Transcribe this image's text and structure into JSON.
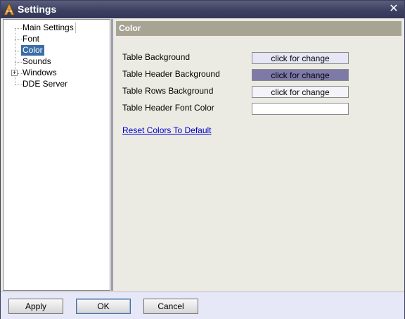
{
  "window": {
    "title": "Settings",
    "close_glyph": "✕"
  },
  "tree": {
    "items": [
      {
        "label": "Main Settings",
        "name": "tree-item-main-settings"
      },
      {
        "label": "Font",
        "name": "tree-item-font"
      },
      {
        "label": "Color",
        "name": "tree-item-color",
        "selected": true
      },
      {
        "label": "Sounds",
        "name": "tree-item-sounds"
      },
      {
        "label": "Windows",
        "name": "tree-item-windows",
        "expandable": true,
        "expander_glyph": "+"
      },
      {
        "label": "DDE Server",
        "name": "tree-item-dde-server"
      }
    ]
  },
  "section": {
    "title": "Color"
  },
  "color_rows": [
    {
      "label": "Table Background",
      "button_label": "click for change",
      "swatch": "#e6e6f5"
    },
    {
      "label": "Table Header Background",
      "button_label": "click for change",
      "swatch": "#7d7aa8"
    },
    {
      "label": "Table Rows Background",
      "button_label": "click for change",
      "swatch": "#f3f3f9"
    },
    {
      "label": "Table Header Font Color",
      "button_label": "",
      "swatch": "#ffffff"
    }
  ],
  "reset_link": "Reset Colors To Default",
  "buttons": {
    "apply": "Apply",
    "ok": "OK",
    "cancel": "Cancel"
  },
  "colors": {
    "titlebar": "#3d4060",
    "selection": "#3a6ea5",
    "header": "#a8a494",
    "link": "#0000cc"
  },
  "icons": {
    "app": "app-logo-icon",
    "close": "close-icon"
  }
}
